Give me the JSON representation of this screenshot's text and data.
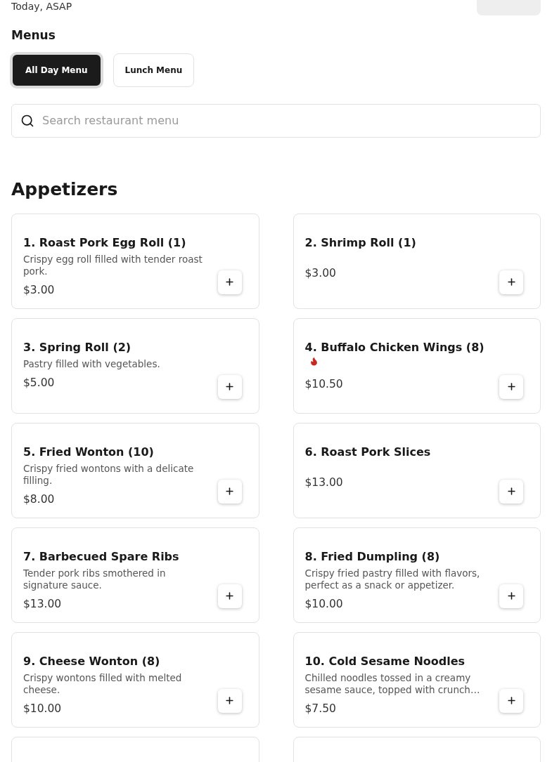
{
  "header": {
    "time": "Today, ASAP"
  },
  "menus": {
    "title": "Menus",
    "tabs": [
      {
        "label": "All Day Menu",
        "selected": true
      },
      {
        "label": "Lunch Menu",
        "selected": false
      }
    ]
  },
  "search": {
    "placeholder": "Search restaurant menu"
  },
  "section": {
    "title": "Appetizers",
    "items": [
      {
        "name": "1. Roast Pork Egg Roll (1)",
        "description": "Crispy egg roll filled with tender roast pork.",
        "price": "$3.00",
        "spicy": false
      },
      {
        "name": "2. Shrimp Roll (1)",
        "price": "$3.00",
        "spicy": false
      },
      {
        "name": "3. Spring Roll (2)",
        "description": "Pastry filled with vegetables.",
        "price": "$5.00",
        "spicy": false
      },
      {
        "name": "4. Buffalo Chicken Wings (8)",
        "price": "$10.50",
        "spicy": true
      },
      {
        "name": "5. Fried Wonton (10)",
        "description": "Crispy fried wontons with a delicate filling.",
        "price": "$8.00",
        "spicy": false
      },
      {
        "name": "6. Roast Pork Slices",
        "price": "$13.00",
        "spicy": false
      },
      {
        "name": "7. Barbecued Spare Ribs",
        "description": "Tender pork ribs smothered in signature sauce.",
        "price": "$13.00",
        "spicy": false
      },
      {
        "name": "8. Fried Dumpling (8)",
        "description": "Crispy fried pastry filled with flavors, perfect as a snack or appetizer.",
        "price": "$10.00",
        "spicy": false
      },
      {
        "name": "9. Cheese Wonton (8)",
        "description": "Crispy wontons filled with melted cheese.",
        "price": "$10.00",
        "spicy": false
      },
      {
        "name": "10. Cold Sesame Noodles",
        "description": "Chilled noodles tossed in a creamy sesame sauce, topped with crunch…",
        "price": "$7.50",
        "spicy": false
      }
    ]
  }
}
